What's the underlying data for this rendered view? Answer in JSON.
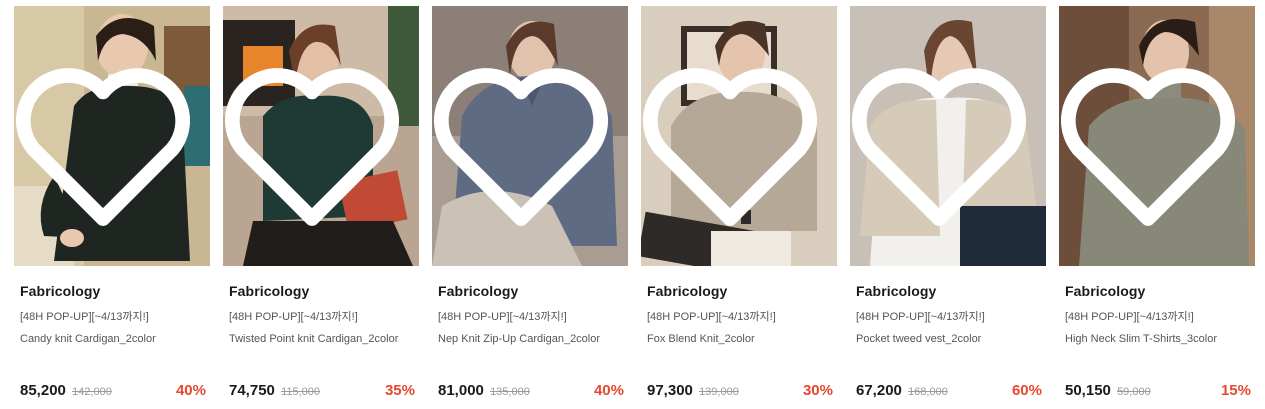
{
  "colors": {
    "discount": "#e8482f",
    "text": "#1a1a1a",
    "muted": "#555555",
    "strike": "#9a9a9a"
  },
  "products": [
    {
      "brand": "Fabricology",
      "tag": "[48H POP-UP][~4/13까지!]",
      "name": "Candy knit Cardigan_2color",
      "price": "85,200",
      "original_price": "142,000",
      "discount": "40%",
      "wishlist_icon": "heart-outline-icon"
    },
    {
      "brand": "Fabricology",
      "tag": "[48H POP-UP][~4/13까지!]",
      "name": "Twisted Point knit Cardigan_2color",
      "price": "74,750",
      "original_price": "115,000",
      "discount": "35%",
      "wishlist_icon": "heart-outline-icon"
    },
    {
      "brand": "Fabricology",
      "tag": "[48H POP-UP][~4/13까지!]",
      "name": "Nep Knit Zip-Up Cardigan_2color",
      "price": "81,000",
      "original_price": "135,000",
      "discount": "40%",
      "wishlist_icon": "heart-outline-icon"
    },
    {
      "brand": "Fabricology",
      "tag": "[48H POP-UP][~4/13까지!]",
      "name": "Fox Blend Knit_2color",
      "price": "97,300",
      "original_price": "139,000",
      "discount": "30%",
      "wishlist_icon": "heart-outline-icon"
    },
    {
      "brand": "Fabricology",
      "tag": "[48H POP-UP][~4/13까지!]",
      "name": "Pocket tweed vest_2color",
      "price": "67,200",
      "original_price": "168,000",
      "discount": "60%",
      "wishlist_icon": "heart-outline-icon"
    },
    {
      "brand": "Fabricology",
      "tag": "[48H POP-UP][~4/13까지!]",
      "name": "High Neck Slim T-Shirts_3color",
      "price": "50,150",
      "original_price": "59,000",
      "discount": "15%",
      "wishlist_icon": "heart-outline-icon"
    }
  ]
}
